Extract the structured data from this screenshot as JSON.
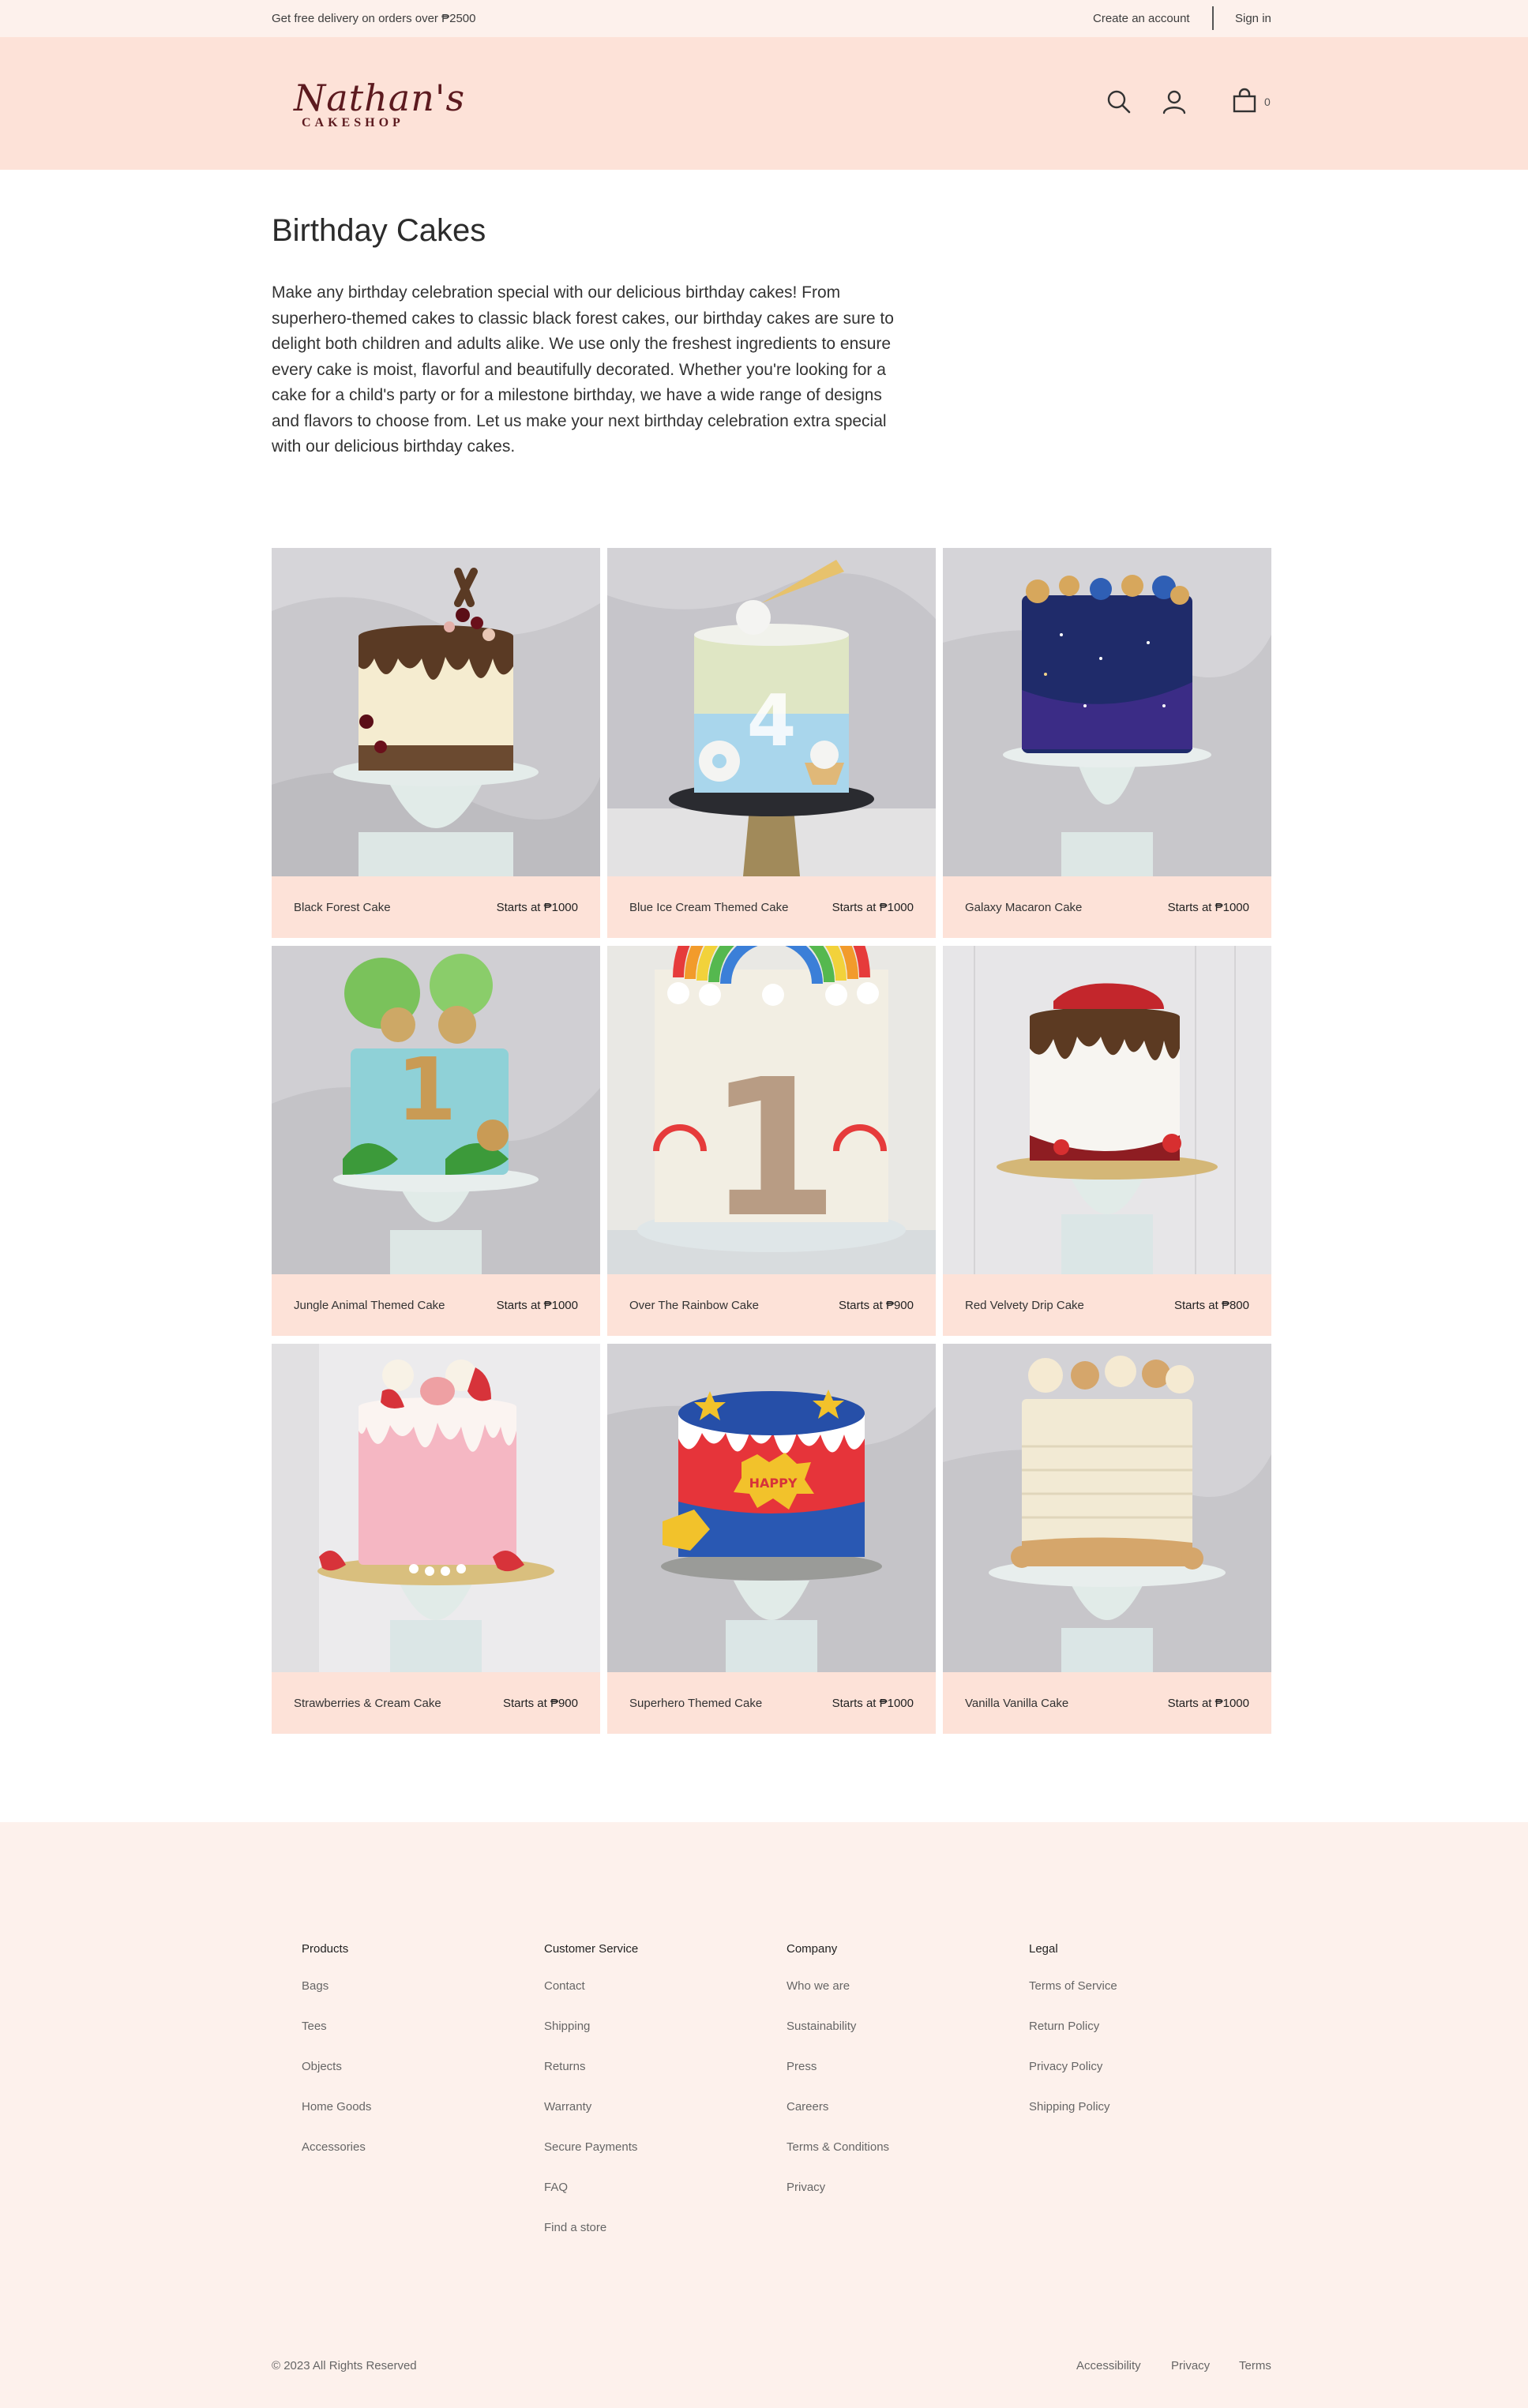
{
  "topbar": {
    "promo": "Get free delivery on orders over ₱2500",
    "create_account": "Create an account",
    "sign_in": "Sign in"
  },
  "header": {
    "logo_script": "Nathan's",
    "logo_sub": "CAKESHOP",
    "cart_count": "0",
    "icons": [
      "search-icon",
      "user-icon",
      "bag-icon"
    ]
  },
  "page": {
    "title": "Birthday Cakes",
    "intro": "Make any birthday celebration special with our delicious birthday cakes! From superhero-themed cakes to classic black forest cakes, our birthday cakes are sure to delight both children and adults alike. We use only the freshest ingredients to ensure every cake is moist, flavorful and beautifully decorated. Whether you're looking for a cake for a child's party or for a milestone birthday, we have a wide range of designs and flavors to choose from. Let us make your next birthday celebration extra special with our delicious birthday cakes."
  },
  "products": [
    {
      "name": "Black Forest Cake",
      "price": "Starts at ₱1000"
    },
    {
      "name": "Blue Ice Cream Themed Cake",
      "price": "Starts at ₱1000"
    },
    {
      "name": "Galaxy Macaron Cake",
      "price": "Starts at ₱1000"
    },
    {
      "name": "Jungle Animal Themed Cake",
      "price": "Starts at ₱1000"
    },
    {
      "name": "Over The Rainbow Cake",
      "price": "Starts at ₱900"
    },
    {
      "name": "Red Velvety Drip Cake",
      "price": "Starts at ₱800"
    },
    {
      "name": "Strawberries & Cream Cake",
      "price": "Starts at ₱900"
    },
    {
      "name": "Superhero Themed Cake",
      "price": "Starts at ₱1000"
    },
    {
      "name": "Vanilla Vanilla Cake",
      "price": "Starts at ₱1000"
    }
  ],
  "footer": {
    "columns": [
      {
        "title": "Products",
        "links": [
          "Bags",
          "Tees",
          "Objects",
          "Home Goods",
          "Accessories"
        ]
      },
      {
        "title": "Customer Service",
        "links": [
          "Contact",
          "Shipping",
          "Returns",
          "Warranty",
          "Secure Payments",
          "FAQ",
          "Find a store"
        ]
      },
      {
        "title": "Company",
        "links": [
          "Who we are",
          "Sustainability",
          "Press",
          "Careers",
          "Terms & Conditions",
          "Privacy"
        ]
      },
      {
        "title": "Legal",
        "links": [
          "Terms of Service",
          "Return Policy",
          "Privacy Policy",
          "Shipping Policy"
        ]
      }
    ],
    "copyright": "© 2023 All Rights Reserved",
    "bottom_links": [
      "Accessibility",
      "Privacy",
      "Terms"
    ]
  },
  "colors": {
    "topbar_bg": "#fdf1ec",
    "header_bg": "#fde2d8",
    "card_info_bg": "#fde2d8",
    "footer_bg": "#fdf1ec",
    "logo": "#5c1a1f"
  }
}
